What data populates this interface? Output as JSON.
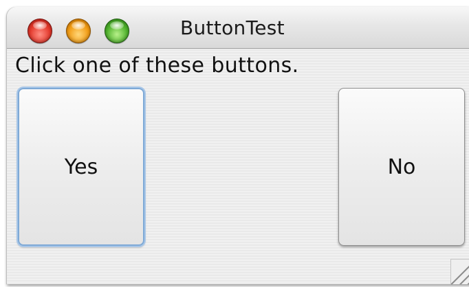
{
  "window": {
    "title": "ButtonTest"
  },
  "content": {
    "instruction": "Click one of these buttons.",
    "yes_label": "Yes",
    "no_label": "No"
  },
  "controls": {
    "close_color": "#e3372a",
    "minimize_color": "#f19a12",
    "zoom_color": "#4fb22c"
  }
}
